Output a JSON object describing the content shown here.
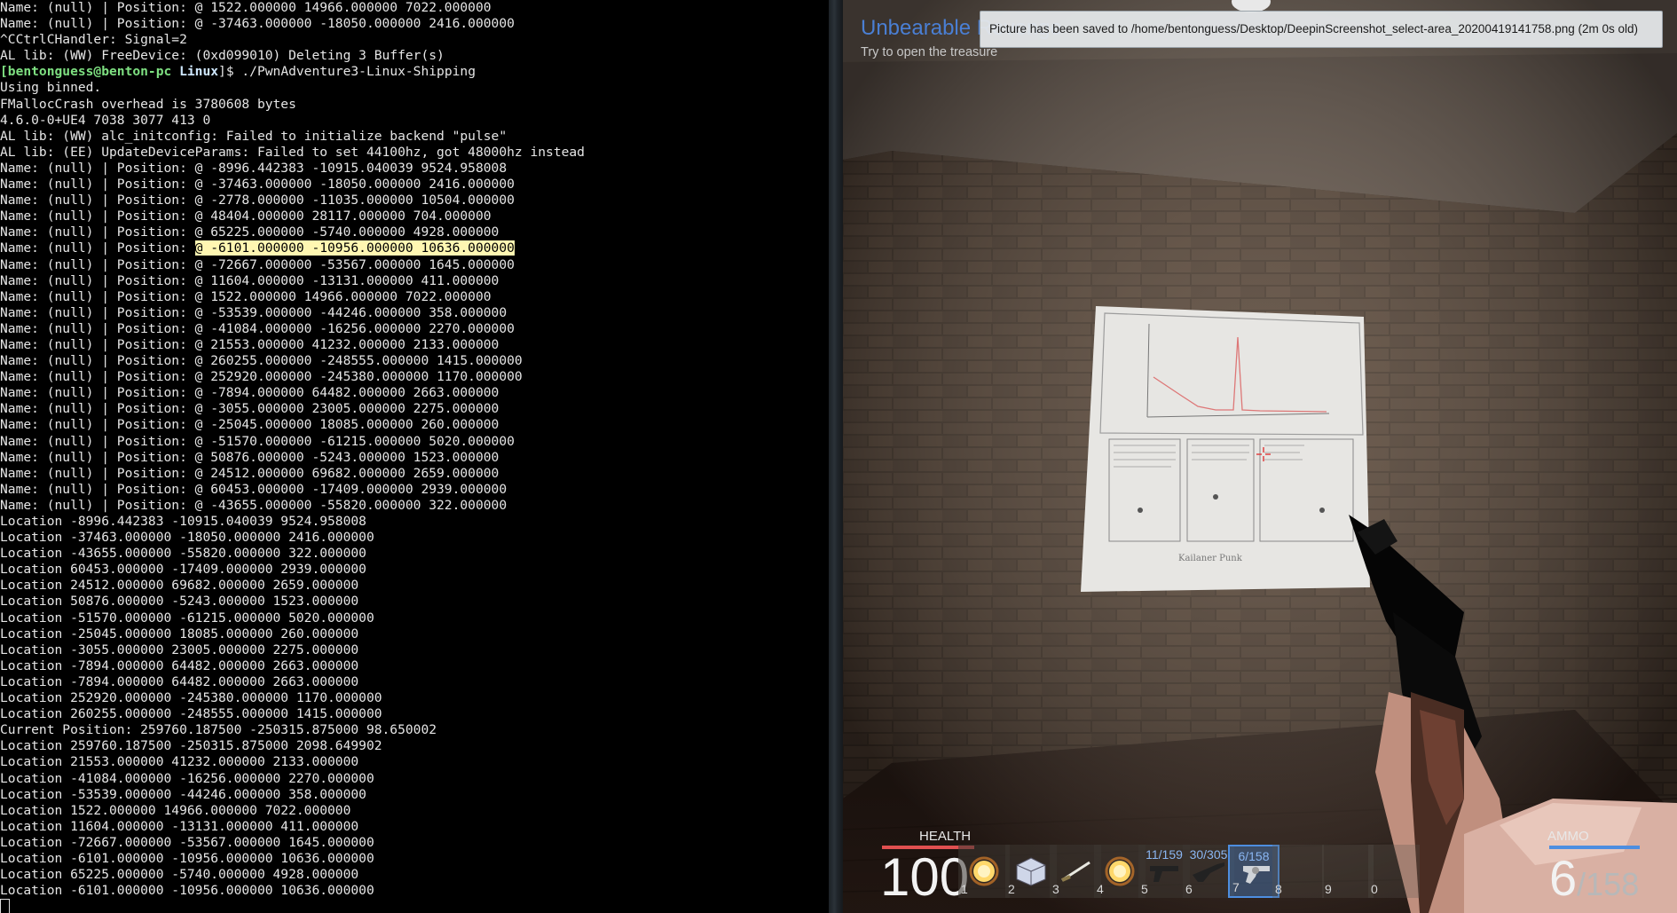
{
  "terminal": {
    "lines": [
      {
        "text": "Name: (null) | Position: @ 1522.000000 14966.000000 7022.000000"
      },
      {
        "text": "Name: (null) | Position: @ -37463.000000 -18050.000000 2416.000000"
      },
      {
        "text": "^CCtrlCHandler: Signal=2"
      },
      {
        "text": "AL lib: (WW) FreeDevice: (0xd099010) Deleting 3 Buffer(s)"
      },
      {
        "prompt": true,
        "user": "[bentonguess@benton-pc ",
        "dir": "Linux",
        "text": "]$ ./PwnAdventure3-Linux-Shipping"
      },
      {
        "text": "Using binned."
      },
      {
        "text": "FMallocCrash overhead is 3780608 bytes"
      },
      {
        "text": "4.6.0-0+UE4 7038 3077 413 0"
      },
      {
        "text": "AL lib: (WW) alc_initconfig: Failed to initialize backend \"pulse\""
      },
      {
        "text": "AL lib: (EE) UpdateDeviceParams: Failed to set 44100hz, got 48000hz instead"
      },
      {
        "text": "Name: (null) | Position: @ -8996.442383 -10915.040039 9524.958008"
      },
      {
        "text": "Name: (null) | Position: @ -37463.000000 -18050.000000 2416.000000"
      },
      {
        "text": "Name: (null) | Position: @ -2778.000000 -11035.000000 10504.000000"
      },
      {
        "text": "Name: (null) | Position: @ 48404.000000 28117.000000 704.000000"
      },
      {
        "text": "Name: (null) | Position: @ 65225.000000 -5740.000000 4928.000000"
      },
      {
        "text": "Name: (null) | Position: ",
        "hl": "@ -6101.000000 -10956.000000 10636.000000"
      },
      {
        "text": "Name: (null) | Position: @ -72667.000000 -53567.000000 1645.000000"
      },
      {
        "text": "Name: (null) | Position: @ 11604.000000 -13131.000000 411.000000"
      },
      {
        "text": "Name: (null) | Position: @ 1522.000000 14966.000000 7022.000000"
      },
      {
        "text": "Name: (null) | Position: @ -53539.000000 -44246.000000 358.000000"
      },
      {
        "text": "Name: (null) | Position: @ -41084.000000 -16256.000000 2270.000000"
      },
      {
        "text": "Name: (null) | Position: @ 21553.000000 41232.000000 2133.000000"
      },
      {
        "text": "Name: (null) | Position: @ 260255.000000 -248555.000000 1415.000000"
      },
      {
        "text": "Name: (null) | Position: @ 252920.000000 -245380.000000 1170.000000"
      },
      {
        "text": "Name: (null) | Position: @ -7894.000000 64482.000000 2663.000000"
      },
      {
        "text": "Name: (null) | Position: @ -3055.000000 23005.000000 2275.000000"
      },
      {
        "text": "Name: (null) | Position: @ -25045.000000 18085.000000 260.000000"
      },
      {
        "text": "Name: (null) | Position: @ -51570.000000 -61215.000000 5020.000000"
      },
      {
        "text": "Name: (null) | Position: @ 50876.000000 -5243.000000 1523.000000"
      },
      {
        "text": "Name: (null) | Position: @ 24512.000000 69682.000000 2659.000000"
      },
      {
        "text": "Name: (null) | Position: @ 60453.000000 -17409.000000 2939.000000"
      },
      {
        "text": "Name: (null) | Position: @ -43655.000000 -55820.000000 322.000000"
      },
      {
        "text": "Location -8996.442383 -10915.040039 9524.958008"
      },
      {
        "text": "Location -37463.000000 -18050.000000 2416.000000"
      },
      {
        "text": "Location -43655.000000 -55820.000000 322.000000"
      },
      {
        "text": "Location 60453.000000 -17409.000000 2939.000000"
      },
      {
        "text": "Location 24512.000000 69682.000000 2659.000000"
      },
      {
        "text": "Location 50876.000000 -5243.000000 1523.000000"
      },
      {
        "text": "Location -51570.000000 -61215.000000 5020.000000"
      },
      {
        "text": "Location -25045.000000 18085.000000 260.000000"
      },
      {
        "text": "Location -3055.000000 23005.000000 2275.000000"
      },
      {
        "text": "Location -7894.000000 64482.000000 2663.000000"
      },
      {
        "text": "Location -7894.000000 64482.000000 2663.000000"
      },
      {
        "text": "Location 252920.000000 -245380.000000 1170.000000"
      },
      {
        "text": "Location 260255.000000 -248555.000000 1415.000000"
      },
      {
        "text": "Current Position: 259760.187500 -250315.875000 98.650002"
      },
      {
        "text": "Location 259760.187500 -250315.875000 2098.649902"
      },
      {
        "text": "Location 21553.000000 41232.000000 2133.000000"
      },
      {
        "text": "Location -41084.000000 -16256.000000 2270.000000"
      },
      {
        "text": "Location -53539.000000 -44246.000000 358.000000"
      },
      {
        "text": "Location 1522.000000 14966.000000 7022.000000"
      },
      {
        "text": "Location 11604.000000 -13131.000000 411.000000"
      },
      {
        "text": "Location -72667.000000 -53567.000000 1645.000000"
      },
      {
        "text": "Location -6101.000000 -10956.000000 10636.000000"
      },
      {
        "text": "Location 65225.000000 -5740.000000 4928.000000"
      },
      {
        "text": "Location -6101.000000 -10956.000000 10636.000000"
      },
      {
        "cursor": true,
        "text": ""
      }
    ]
  },
  "game": {
    "quest": {
      "title": "Unbearable Revenge",
      "subtitle": "Try to open the treasure"
    },
    "toast": "Picture has been saved to /home/bentonguess/Desktop/DeepinScreenshot_select-area_20200419141758.png (2m 0s old)",
    "poster_caption": "Kailaner Punk",
    "hud": {
      "health_label": "HEALTH",
      "health_value": "100",
      "ammo_label": "AMMO",
      "ammo_current": "6",
      "ammo_total": "/158",
      "health_bar_color": "#e05050",
      "ammo_bar_color": "#4d8ee0",
      "slots": [
        {
          "num": "1",
          "icon": "fireball-icon",
          "count": ""
        },
        {
          "num": "2",
          "icon": "ice-cube-icon",
          "count": ""
        },
        {
          "num": "3",
          "icon": "sword-icon",
          "count": ""
        },
        {
          "num": "4",
          "icon": "fireball-icon",
          "count": ""
        },
        {
          "num": "5",
          "icon": "pistol-icon",
          "count": "11/159"
        },
        {
          "num": "6",
          "icon": "rifle-icon",
          "count": "30/305"
        },
        {
          "num": "7",
          "icon": "revolver-icon",
          "count": "6/158",
          "active": true
        },
        {
          "num": "8",
          "icon": "",
          "count": ""
        },
        {
          "num": "9",
          "icon": "",
          "count": ""
        },
        {
          "num": "0",
          "icon": "",
          "count": ""
        }
      ]
    }
  }
}
